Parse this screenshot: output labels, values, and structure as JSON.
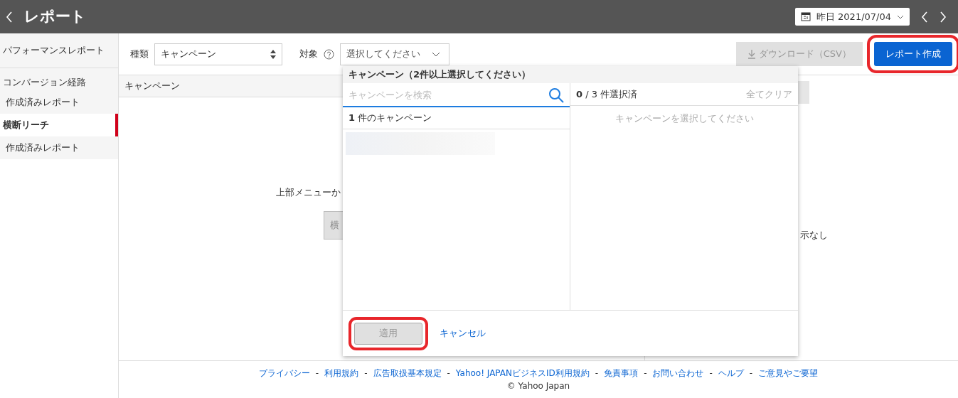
{
  "header": {
    "title": "レポート",
    "date": "昨日 2021/07/04"
  },
  "sidebar": {
    "items": [
      {
        "label": "パフォーマンスレポート",
        "selected": false
      },
      {
        "label": "コンバージョン経路",
        "selected": false,
        "children": [
          {
            "label": "作成済みレポート",
            "selected": false
          }
        ]
      },
      {
        "label": "横断リーチ",
        "selected": true,
        "children": [
          {
            "label": "作成済みレポート",
            "selected": false
          }
        ]
      }
    ]
  },
  "toolbar": {
    "type_label": "種類",
    "type_value": "キャンペーン",
    "target_label": "対象",
    "target_value": "選択してください",
    "download_button": {
      "label": "ダウンロード（CSV）",
      "disabled": true
    },
    "create_button": {
      "label": "レポート作成",
      "disabled": false,
      "highlighted": true
    }
  },
  "table": {
    "columns": [
      "キャンペーン"
    ]
  },
  "message": "上部メニューか",
  "cut_button": "横",
  "right_text": "示なし",
  "dropdown": {
    "title": "キャンペーン（2件以上選択してください）",
    "search": {
      "placeholder": "キャンペーンを検索"
    },
    "count": "**1** 件のキャンペーン",
    "selected_count": "**0** / 3 件選択済",
    "clear": "全てクリア",
    "empty": "キャンペーンを選択してください",
    "apply": {
      "label": "適用",
      "disabled": true,
      "highlighted": true
    },
    "cancel": "キャンセル"
  },
  "footer": {
    "links": [
      "プライバシー",
      "利用規約",
      "広告取扱基本規定",
      "Yahoo! JAPANビジネスID利用規約",
      "免責事項",
      "お問い合わせ",
      "ヘルプ",
      "ご意見やご要望"
    ],
    "separator": "-",
    "copyright": "© Yahoo Japan"
  }
}
